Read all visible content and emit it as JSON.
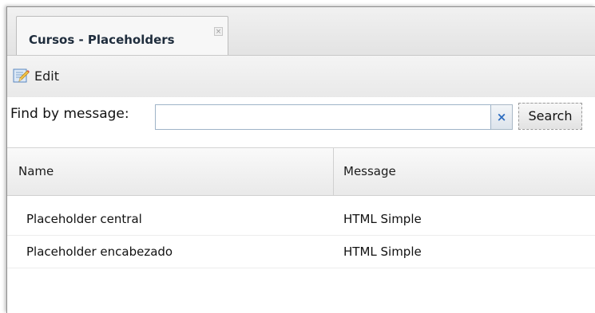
{
  "tab": {
    "title": "Cursos - Placeholders",
    "close_glyph": "×"
  },
  "toolbar": {
    "edit_label": "Edit",
    "edit_icon": "edit-icon"
  },
  "search": {
    "label": "Find by message:",
    "value": "",
    "clear_glyph": "×",
    "button_label": "Search"
  },
  "grid": {
    "columns": [
      "Name",
      "Message"
    ],
    "rows": [
      {
        "name": "Placeholder central",
        "message": "HTML Simple"
      },
      {
        "name": "Placeholder encabezado",
        "message": "HTML Simple"
      }
    ]
  },
  "colors": {
    "accent": "#2d6cbf",
    "tab_text": "#1f2d3d",
    "header_bg": "#e9e9e9"
  }
}
